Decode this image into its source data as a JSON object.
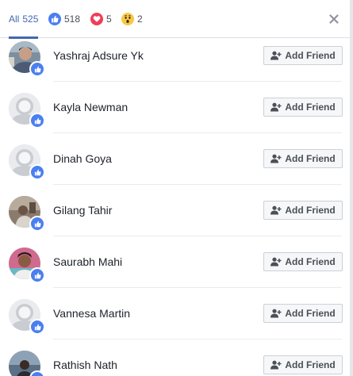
{
  "tabs": {
    "all": {
      "label": "All",
      "count": "525"
    },
    "like": {
      "count": "518",
      "icon": "like-icon"
    },
    "love": {
      "count": "5",
      "icon": "heart-icon"
    },
    "wow": {
      "count": "2",
      "icon": "wow-icon"
    }
  },
  "close_icon": "close-icon",
  "people": [
    {
      "name": "Yashraj Adsure Yk",
      "avatar": "photo-1",
      "button": "Add Friend"
    },
    {
      "name": "Kayla Newman",
      "avatar": "default-silhouette",
      "button": "Add Friend"
    },
    {
      "name": "Dinah Goya",
      "avatar": "default-silhouette",
      "button": "Add Friend"
    },
    {
      "name": "Gilang Tahir",
      "avatar": "photo-2",
      "button": "Add Friend"
    },
    {
      "name": "Saurabh Mahi",
      "avatar": "photo-3",
      "button": "Add Friend"
    },
    {
      "name": "Vannesa Martin",
      "avatar": "default-silhouette",
      "button": "Add Friend"
    },
    {
      "name": "Rathish Nath",
      "avatar": "photo-4",
      "button": "Add Friend"
    }
  ],
  "colors": {
    "accent": "#4267b2",
    "like": "#4a7ff0",
    "love": "#ef3e58",
    "wow": "#f7c845"
  }
}
